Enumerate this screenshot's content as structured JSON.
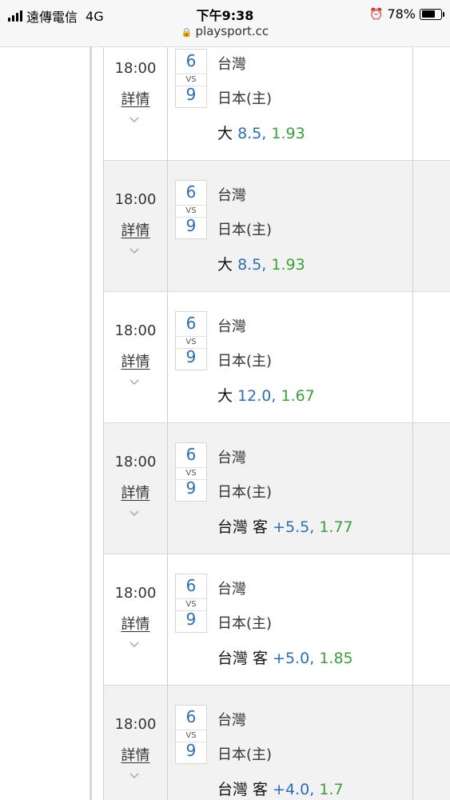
{
  "status_bar": {
    "carrier": "遠傳電信",
    "network": "4G",
    "time": "下午9:38",
    "battery": "78%",
    "battery_level": 0.78,
    "url": "playsport.cc"
  },
  "matches": [
    {
      "time": "18:00",
      "detail": "詳情",
      "home_score": "6",
      "vs": "VS",
      "away_score": "9",
      "team1": "台灣",
      "team2": "日本(主)",
      "bet_label": "大",
      "bet_value": "8.5,",
      "bet_odds": "1.93"
    },
    {
      "time": "18:00",
      "detail": "詳情",
      "home_score": "6",
      "vs": "VS",
      "away_score": "9",
      "team1": "台灣",
      "team2": "日本(主)",
      "bet_label": "大",
      "bet_value": "8.5,",
      "bet_odds": "1.93"
    },
    {
      "time": "18:00",
      "detail": "詳情",
      "home_score": "6",
      "vs": "VS",
      "away_score": "9",
      "team1": "台灣",
      "team2": "日本(主)",
      "bet_label": "大",
      "bet_value": "12.0,",
      "bet_odds": "1.67"
    },
    {
      "time": "18:00",
      "detail": "詳情",
      "home_score": "6",
      "vs": "VS",
      "away_score": "9",
      "team1": "台灣",
      "team2": "日本(主)",
      "bet_label": "台灣 客",
      "bet_value": "+5.5,",
      "bet_odds": "1.77"
    },
    {
      "time": "18:00",
      "detail": "詳情",
      "home_score": "6",
      "vs": "VS",
      "away_score": "9",
      "team1": "台灣",
      "team2": "日本(主)",
      "bet_label": "台灣 客",
      "bet_value": "+5.0,",
      "bet_odds": "1.85"
    },
    {
      "time": "18:00",
      "detail": "詳情",
      "home_score": "6",
      "vs": "VS",
      "away_score": "9",
      "team1": "台灣",
      "team2": "日本(主)",
      "bet_label": "台灣 客",
      "bet_value": "+4.0,",
      "bet_odds": "1.7"
    }
  ],
  "colors": {
    "value_blue": "#2a6ebb",
    "odds_green": "#3aa139",
    "row_shade": "#f2f2f2"
  }
}
